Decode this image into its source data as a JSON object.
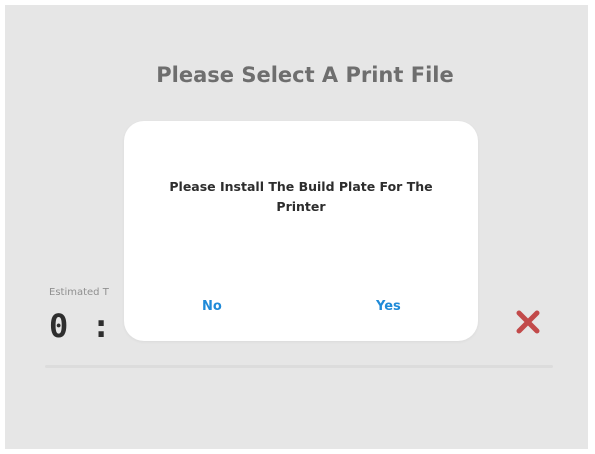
{
  "background": {
    "title": "Please Select A Print File",
    "estimated_label": "Estimated T",
    "timer_text": "0 : 0"
  },
  "dialog": {
    "message": "Please Install The Build Plate For The Printer",
    "no_label": "No",
    "yes_label": "Yes"
  },
  "colors": {
    "overlay_bg": "#e6e6e6",
    "dialog_bg": "#ffffff",
    "button_text": "#1f8ad8",
    "cancel_icon": "#c24a4a"
  },
  "icons": {
    "cancel": "close-icon"
  }
}
